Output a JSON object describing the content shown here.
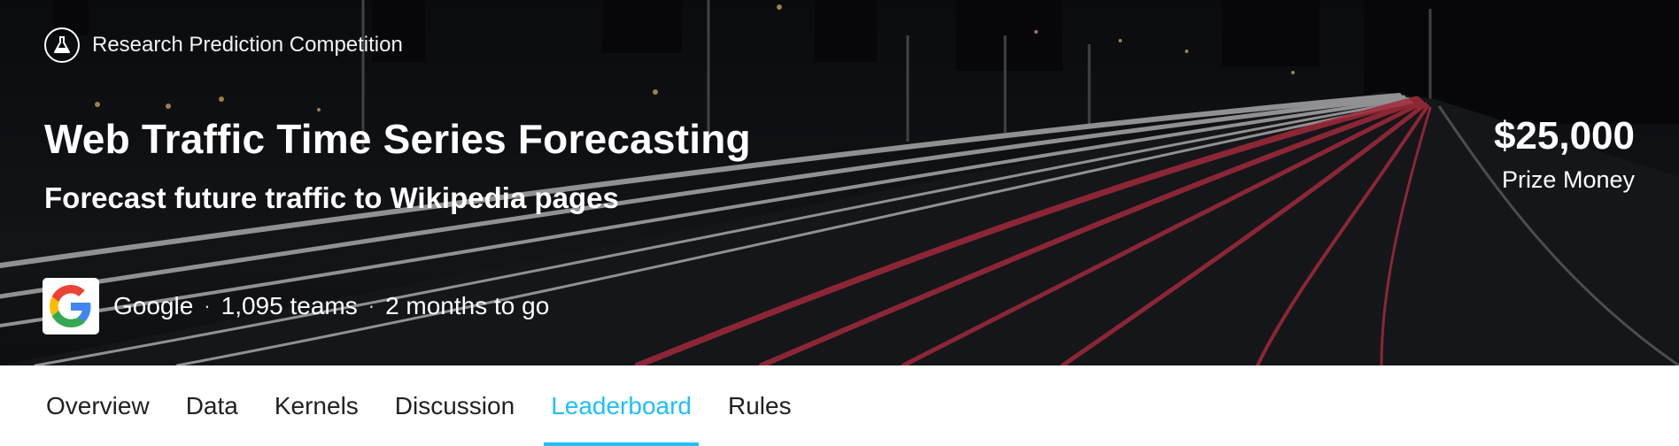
{
  "competition": {
    "category_label": "Research Prediction Competition",
    "category_icon": "flask-icon",
    "title": "Web Traffic Time Series Forecasting",
    "subtitle": "Forecast future traffic to Wikipedia pages",
    "host": "Google",
    "host_logo_icon": "google-logo",
    "teams": "1,095 teams",
    "time_left": "2 months to go",
    "separator": "·",
    "prize_amount": "$25,000",
    "prize_label": "Prize Money"
  },
  "tabs": {
    "items": [
      {
        "label": "Overview"
      },
      {
        "label": "Data"
      },
      {
        "label": "Kernels"
      },
      {
        "label": "Discussion"
      },
      {
        "label": "Leaderboard"
      },
      {
        "label": "Rules"
      }
    ],
    "active": "Leaderboard"
  },
  "colors": {
    "accent": "#20beff",
    "tab_text": "#202124",
    "hero_text": "#ffffff"
  }
}
